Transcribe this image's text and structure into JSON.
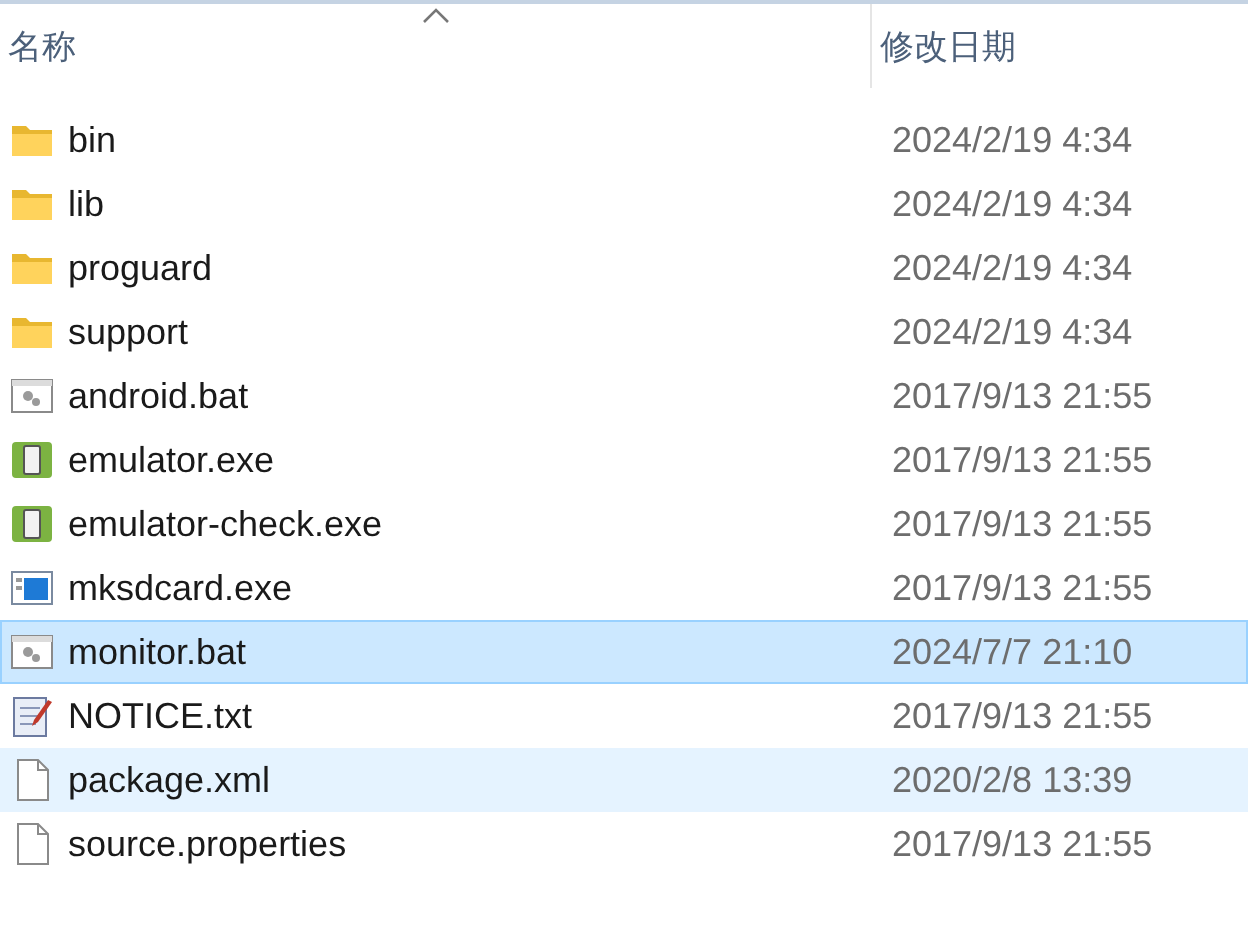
{
  "columns": [
    {
      "label": "名称",
      "sorted": true
    },
    {
      "label": "修改日期",
      "sorted": false
    }
  ],
  "rows": [
    {
      "name": "bin",
      "date": "2024/2/19 4:34",
      "kind": "folder",
      "selected": false,
      "hovered": false
    },
    {
      "name": "lib",
      "date": "2024/2/19 4:34",
      "kind": "folder",
      "selected": false,
      "hovered": false
    },
    {
      "name": "proguard",
      "date": "2024/2/19 4:34",
      "kind": "folder",
      "selected": false,
      "hovered": false
    },
    {
      "name": "support",
      "date": "2024/2/19 4:34",
      "kind": "folder",
      "selected": false,
      "hovered": false
    },
    {
      "name": "android.bat",
      "date": "2017/9/13 21:55",
      "kind": "script",
      "selected": false,
      "hovered": false
    },
    {
      "name": "emulator.exe",
      "date": "2017/9/13 21:55",
      "kind": "phone-app",
      "selected": false,
      "hovered": false
    },
    {
      "name": "emulator-check.exe",
      "date": "2017/9/13 21:55",
      "kind": "phone-app",
      "selected": false,
      "hovered": false
    },
    {
      "name": "mksdcard.exe",
      "date": "2017/9/13 21:55",
      "kind": "window-app",
      "selected": false,
      "hovered": false
    },
    {
      "name": "monitor.bat",
      "date": "2024/7/7 21:10",
      "kind": "script",
      "selected": true,
      "hovered": false
    },
    {
      "name": "NOTICE.txt",
      "date": "2017/9/13 21:55",
      "kind": "text",
      "selected": false,
      "hovered": false
    },
    {
      "name": "package.xml",
      "date": "2020/2/8 13:39",
      "kind": "file",
      "selected": false,
      "hovered": true
    },
    {
      "name": "source.properties",
      "date": "2017/9/13 21:55",
      "kind": "file",
      "selected": false,
      "hovered": false
    }
  ]
}
